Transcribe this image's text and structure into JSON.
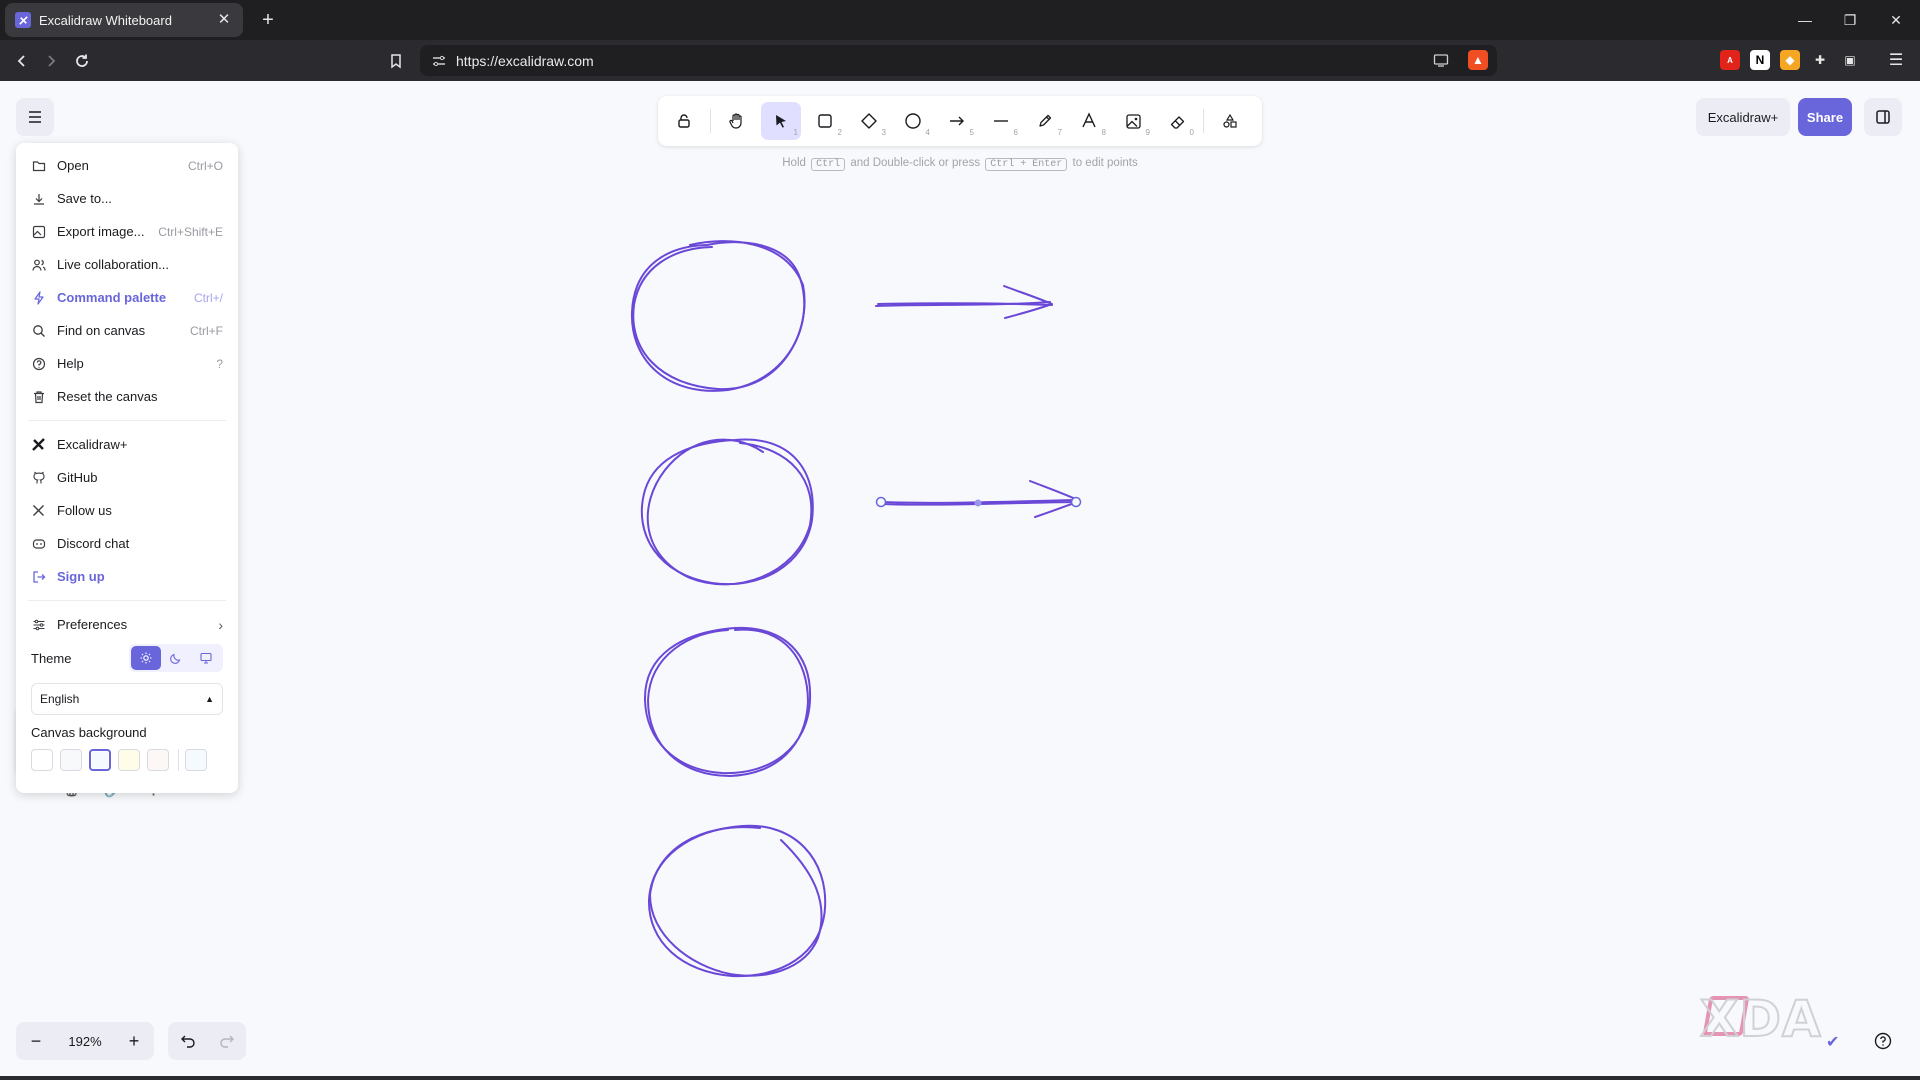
{
  "browser": {
    "tab_title": "Excalidraw Whiteboard",
    "url": "https://excalidraw.com"
  },
  "toolbar": {
    "tools": [
      {
        "name": "lock",
        "key": ""
      },
      {
        "name": "hand",
        "key": ""
      },
      {
        "name": "selection",
        "key": "1"
      },
      {
        "name": "rectangle",
        "key": "2"
      },
      {
        "name": "diamond",
        "key": "3"
      },
      {
        "name": "ellipse",
        "key": "4"
      },
      {
        "name": "arrow",
        "key": "5"
      },
      {
        "name": "line",
        "key": "6"
      },
      {
        "name": "draw",
        "key": "7"
      },
      {
        "name": "text",
        "key": "8"
      },
      {
        "name": "image",
        "key": "9"
      },
      {
        "name": "eraser",
        "key": "0"
      },
      {
        "name": "more-tools",
        "key": ""
      }
    ],
    "active_tool": "selection"
  },
  "hint": {
    "part1": "Hold",
    "kbd1": "Ctrl",
    "part2": "and Double-click or press",
    "kbd2": "Ctrl + Enter",
    "part3": "to edit points"
  },
  "header_right": {
    "plus_label": "Excalidraw+",
    "share_label": "Share"
  },
  "menu": {
    "items": [
      {
        "label": "Open",
        "shortcut": "Ctrl+O",
        "icon": "folder-icon"
      },
      {
        "label": "Save to...",
        "shortcut": "",
        "icon": "download-icon"
      },
      {
        "label": "Export image...",
        "shortcut": "Ctrl+Shift+E",
        "icon": "export-image-icon"
      },
      {
        "label": "Live collaboration...",
        "shortcut": "",
        "icon": "users-icon"
      },
      {
        "label": "Command palette",
        "shortcut": "Ctrl+/",
        "icon": "bolt-icon"
      },
      {
        "label": "Find on canvas",
        "shortcut": "Ctrl+F",
        "icon": "search-icon"
      },
      {
        "label": "Help",
        "shortcut": "?",
        "icon": "help-icon"
      },
      {
        "label": "Reset the canvas",
        "shortcut": "",
        "icon": "trash-icon"
      }
    ],
    "links": [
      {
        "label": "Excalidraw+",
        "icon": "excalidraw-plus-icon"
      },
      {
        "label": "GitHub",
        "icon": "github-icon"
      },
      {
        "label": "Follow us",
        "icon": "x-logo-icon"
      },
      {
        "label": "Discord chat",
        "icon": "discord-icon"
      },
      {
        "label": "Sign up",
        "icon": "sign-up-icon"
      }
    ],
    "preferences_label": "Preferences",
    "theme_label": "Theme",
    "theme_selected": "light",
    "language": "English",
    "canvas_background_label": "Canvas background",
    "canvas_background_colors": [
      "#ffffff",
      "#f8f9fa",
      "#f5faff",
      "#fffce8",
      "#fdf8f6"
    ],
    "canvas_background_selected": "#f5faff",
    "custom_color": "#f5faff"
  },
  "footer": {
    "zoom": "192%"
  },
  "colors": {
    "accent": "#6965db",
    "stroke": "#6a48d7",
    "canvas": "#f8f9fc"
  }
}
